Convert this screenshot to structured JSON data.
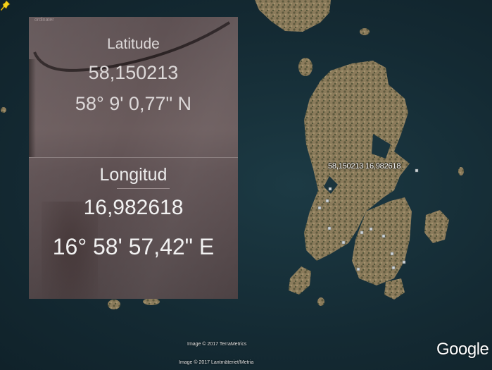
{
  "map": {
    "pin_label": "58,150213 16,982618",
    "attribution_1": "Image © 2017 TerraMetrics",
    "attribution_2": "Image © 2017 Lantmäteriet/Metria",
    "logo": "Google",
    "colors": {
      "water": "#17303a",
      "land": "#8a7a5a",
      "pin": "#f5d21a"
    },
    "icons": [
      "map-pin-icon"
    ]
  },
  "photo": {
    "header": "ordinater",
    "latitude_label": "Latitude",
    "latitude_decimal": "58,150213",
    "latitude_dms": "58° 9' 0,77\" N",
    "longitude_label": "Longitud",
    "longitude_decimal": "16,982618",
    "longitude_dms": "16° 58' 57,42\" E"
  }
}
